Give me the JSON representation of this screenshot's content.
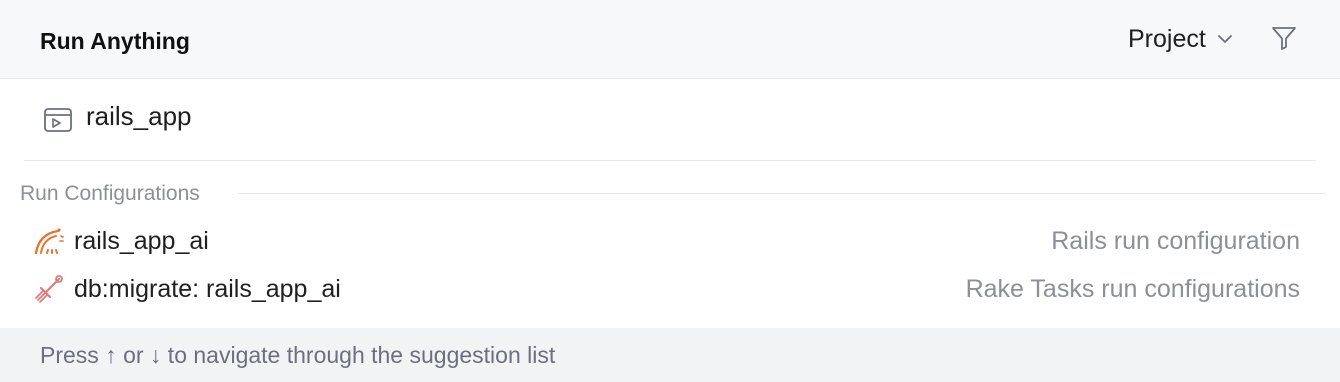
{
  "header": {
    "title": "Run Anything",
    "scope_label": "Project",
    "chevron_icon": "chevron-down-icon",
    "filter_icon": "filter-icon"
  },
  "input": {
    "value": "rails_app",
    "icon": "run-console-icon"
  },
  "sections": [
    {
      "label": "Run Configurations",
      "items": [
        {
          "name": "rails_app_ai",
          "hint": "Rails run configuration",
          "icon": "rails-icon",
          "icon_color": "#e8742f"
        },
        {
          "name": "db:migrate: rails_app_ai",
          "hint": "Rake Tasks run configurations",
          "icon": "rake-icon",
          "icon_color": "#e47a7a"
        }
      ]
    }
  ],
  "footer": {
    "hint": "Press ↑ or ↓ to navigate through the suggestion list"
  },
  "colors": {
    "header_bg": "#f7f8fa",
    "footer_bg": "#f2f3f5",
    "muted_text": "#8c8f96",
    "divider": "#e6e8ec"
  }
}
